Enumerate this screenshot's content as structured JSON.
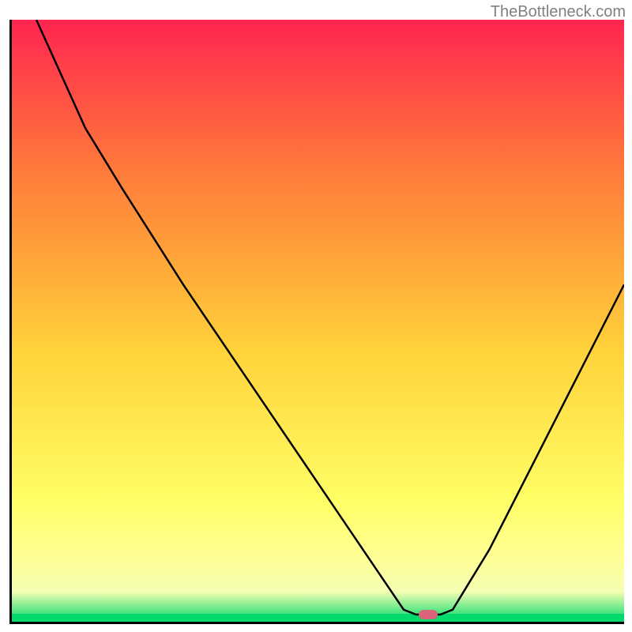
{
  "watermark": "TheBottleneck.com",
  "chart_data": {
    "type": "line",
    "title": "",
    "xlabel": "",
    "ylabel": "",
    "xlim": [
      0,
      100
    ],
    "ylim": [
      0,
      100
    ],
    "grid": false,
    "gradient_colors": {
      "top": "#ff2550",
      "upper_mid": "#ff7a3a",
      "mid": "#ffd23a",
      "lower_mid": "#ffff66",
      "band_yellow": "#ffff99",
      "band_yellow2": "#f5ffb3",
      "bottom": "#00d96b"
    },
    "curve_points": [
      {
        "x": 4,
        "y": 100
      },
      {
        "x": 12,
        "y": 82
      },
      {
        "x": 18,
        "y": 72
      },
      {
        "x": 28,
        "y": 56
      },
      {
        "x": 40,
        "y": 38
      },
      {
        "x": 52,
        "y": 20
      },
      {
        "x": 60,
        "y": 8
      },
      {
        "x": 64,
        "y": 2
      },
      {
        "x": 66,
        "y": 1.2
      },
      {
        "x": 70,
        "y": 1.2
      },
      {
        "x": 72,
        "y": 2
      },
      {
        "x": 78,
        "y": 12
      },
      {
        "x": 86,
        "y": 28
      },
      {
        "x": 94,
        "y": 44
      },
      {
        "x": 100,
        "y": 56
      }
    ],
    "marker": {
      "x": 68,
      "y": 1.2,
      "color": "#d8637a"
    }
  }
}
